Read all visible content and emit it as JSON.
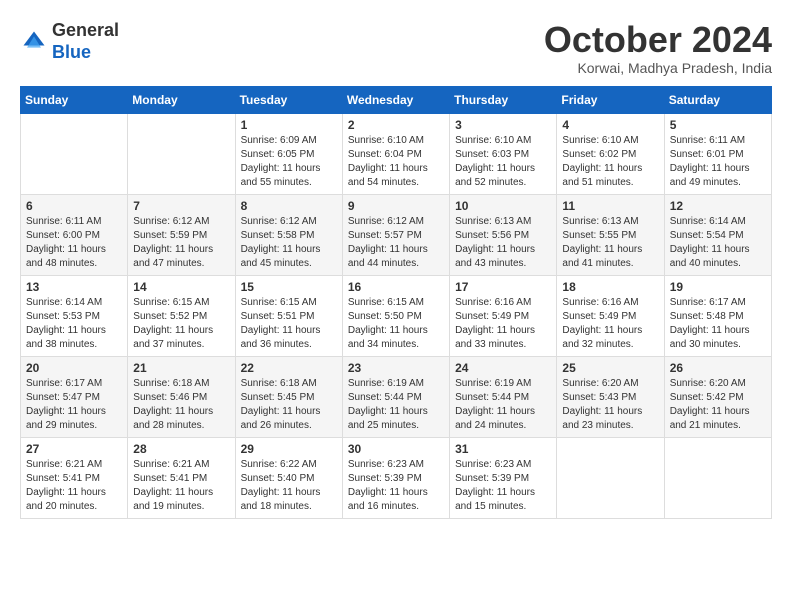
{
  "header": {
    "logo": {
      "line1": "General",
      "line2": "Blue"
    },
    "title": "October 2024",
    "location": "Korwai, Madhya Pradesh, India"
  },
  "weekdays": [
    "Sunday",
    "Monday",
    "Tuesday",
    "Wednesday",
    "Thursday",
    "Friday",
    "Saturday"
  ],
  "weeks": [
    [
      {
        "day": "",
        "sunrise": "",
        "sunset": "",
        "daylight": ""
      },
      {
        "day": "",
        "sunrise": "",
        "sunset": "",
        "daylight": ""
      },
      {
        "day": "1",
        "sunrise": "Sunrise: 6:09 AM",
        "sunset": "Sunset: 6:05 PM",
        "daylight": "Daylight: 11 hours and 55 minutes."
      },
      {
        "day": "2",
        "sunrise": "Sunrise: 6:10 AM",
        "sunset": "Sunset: 6:04 PM",
        "daylight": "Daylight: 11 hours and 54 minutes."
      },
      {
        "day": "3",
        "sunrise": "Sunrise: 6:10 AM",
        "sunset": "Sunset: 6:03 PM",
        "daylight": "Daylight: 11 hours and 52 minutes."
      },
      {
        "day": "4",
        "sunrise": "Sunrise: 6:10 AM",
        "sunset": "Sunset: 6:02 PM",
        "daylight": "Daylight: 11 hours and 51 minutes."
      },
      {
        "day": "5",
        "sunrise": "Sunrise: 6:11 AM",
        "sunset": "Sunset: 6:01 PM",
        "daylight": "Daylight: 11 hours and 49 minutes."
      }
    ],
    [
      {
        "day": "6",
        "sunrise": "Sunrise: 6:11 AM",
        "sunset": "Sunset: 6:00 PM",
        "daylight": "Daylight: 11 hours and 48 minutes."
      },
      {
        "day": "7",
        "sunrise": "Sunrise: 6:12 AM",
        "sunset": "Sunset: 5:59 PM",
        "daylight": "Daylight: 11 hours and 47 minutes."
      },
      {
        "day": "8",
        "sunrise": "Sunrise: 6:12 AM",
        "sunset": "Sunset: 5:58 PM",
        "daylight": "Daylight: 11 hours and 45 minutes."
      },
      {
        "day": "9",
        "sunrise": "Sunrise: 6:12 AM",
        "sunset": "Sunset: 5:57 PM",
        "daylight": "Daylight: 11 hours and 44 minutes."
      },
      {
        "day": "10",
        "sunrise": "Sunrise: 6:13 AM",
        "sunset": "Sunset: 5:56 PM",
        "daylight": "Daylight: 11 hours and 43 minutes."
      },
      {
        "day": "11",
        "sunrise": "Sunrise: 6:13 AM",
        "sunset": "Sunset: 5:55 PM",
        "daylight": "Daylight: 11 hours and 41 minutes."
      },
      {
        "day": "12",
        "sunrise": "Sunrise: 6:14 AM",
        "sunset": "Sunset: 5:54 PM",
        "daylight": "Daylight: 11 hours and 40 minutes."
      }
    ],
    [
      {
        "day": "13",
        "sunrise": "Sunrise: 6:14 AM",
        "sunset": "Sunset: 5:53 PM",
        "daylight": "Daylight: 11 hours and 38 minutes."
      },
      {
        "day": "14",
        "sunrise": "Sunrise: 6:15 AM",
        "sunset": "Sunset: 5:52 PM",
        "daylight": "Daylight: 11 hours and 37 minutes."
      },
      {
        "day": "15",
        "sunrise": "Sunrise: 6:15 AM",
        "sunset": "Sunset: 5:51 PM",
        "daylight": "Daylight: 11 hours and 36 minutes."
      },
      {
        "day": "16",
        "sunrise": "Sunrise: 6:15 AM",
        "sunset": "Sunset: 5:50 PM",
        "daylight": "Daylight: 11 hours and 34 minutes."
      },
      {
        "day": "17",
        "sunrise": "Sunrise: 6:16 AM",
        "sunset": "Sunset: 5:49 PM",
        "daylight": "Daylight: 11 hours and 33 minutes."
      },
      {
        "day": "18",
        "sunrise": "Sunrise: 6:16 AM",
        "sunset": "Sunset: 5:49 PM",
        "daylight": "Daylight: 11 hours and 32 minutes."
      },
      {
        "day": "19",
        "sunrise": "Sunrise: 6:17 AM",
        "sunset": "Sunset: 5:48 PM",
        "daylight": "Daylight: 11 hours and 30 minutes."
      }
    ],
    [
      {
        "day": "20",
        "sunrise": "Sunrise: 6:17 AM",
        "sunset": "Sunset: 5:47 PM",
        "daylight": "Daylight: 11 hours and 29 minutes."
      },
      {
        "day": "21",
        "sunrise": "Sunrise: 6:18 AM",
        "sunset": "Sunset: 5:46 PM",
        "daylight": "Daylight: 11 hours and 28 minutes."
      },
      {
        "day": "22",
        "sunrise": "Sunrise: 6:18 AM",
        "sunset": "Sunset: 5:45 PM",
        "daylight": "Daylight: 11 hours and 26 minutes."
      },
      {
        "day": "23",
        "sunrise": "Sunrise: 6:19 AM",
        "sunset": "Sunset: 5:44 PM",
        "daylight": "Daylight: 11 hours and 25 minutes."
      },
      {
        "day": "24",
        "sunrise": "Sunrise: 6:19 AM",
        "sunset": "Sunset: 5:44 PM",
        "daylight": "Daylight: 11 hours and 24 minutes."
      },
      {
        "day": "25",
        "sunrise": "Sunrise: 6:20 AM",
        "sunset": "Sunset: 5:43 PM",
        "daylight": "Daylight: 11 hours and 23 minutes."
      },
      {
        "day": "26",
        "sunrise": "Sunrise: 6:20 AM",
        "sunset": "Sunset: 5:42 PM",
        "daylight": "Daylight: 11 hours and 21 minutes."
      }
    ],
    [
      {
        "day": "27",
        "sunrise": "Sunrise: 6:21 AM",
        "sunset": "Sunset: 5:41 PM",
        "daylight": "Daylight: 11 hours and 20 minutes."
      },
      {
        "day": "28",
        "sunrise": "Sunrise: 6:21 AM",
        "sunset": "Sunset: 5:41 PM",
        "daylight": "Daylight: 11 hours and 19 minutes."
      },
      {
        "day": "29",
        "sunrise": "Sunrise: 6:22 AM",
        "sunset": "Sunset: 5:40 PM",
        "daylight": "Daylight: 11 hours and 18 minutes."
      },
      {
        "day": "30",
        "sunrise": "Sunrise: 6:23 AM",
        "sunset": "Sunset: 5:39 PM",
        "daylight": "Daylight: 11 hours and 16 minutes."
      },
      {
        "day": "31",
        "sunrise": "Sunrise: 6:23 AM",
        "sunset": "Sunset: 5:39 PM",
        "daylight": "Daylight: 11 hours and 15 minutes."
      },
      {
        "day": "",
        "sunrise": "",
        "sunset": "",
        "daylight": ""
      },
      {
        "day": "",
        "sunrise": "",
        "sunset": "",
        "daylight": ""
      }
    ]
  ]
}
